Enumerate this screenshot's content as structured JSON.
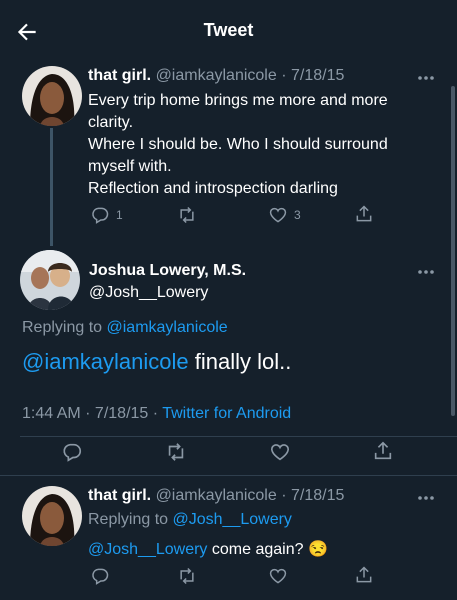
{
  "header": {
    "title": "Tweet"
  },
  "tweet1": {
    "name": "that girl.",
    "handle": "@iamkaylanicole",
    "date": "· 7/18/15",
    "lines": [
      "Every trip home brings me more and more",
      "clarity.",
      "Where I should be. Who I should surround",
      "myself with.",
      "Reflection and introspection darling"
    ],
    "reply_count": "1",
    "like_count": "3"
  },
  "main": {
    "name": "Joshua Lowery, M.S.",
    "handle": "@Josh__Lowery",
    "replying_prefix": "Replying to",
    "replying_to": "@iamkaylanicole",
    "mention": "@iamkaylanicole",
    "body": " finally lol..",
    "time": "1:44 AM · 7/18/15 ·",
    "source": "Twitter for Android"
  },
  "reply": {
    "name": "that girl.",
    "handle": "@iamkaylanicole",
    "date": "· 7/18/15",
    "replying_prefix": "Replying to",
    "replying_to": "@Josh__Lowery",
    "mention": "@Josh__Lowery",
    "body": " come again?",
    "emoji": "😒"
  },
  "colors": {
    "background": "#15202b",
    "accent": "#1d9bf0",
    "muted": "#8b98a5"
  }
}
